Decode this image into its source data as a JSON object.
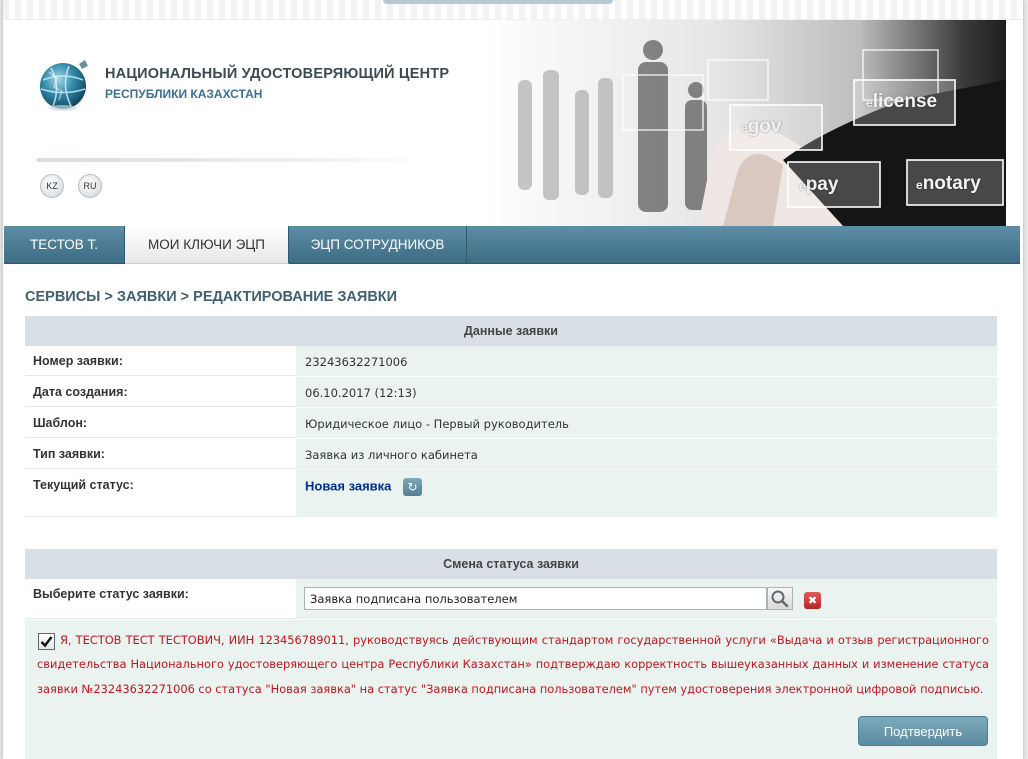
{
  "header": {
    "org_name": "НАЦИОНАЛЬНЫЙ УДОСТОВЕРЯЮЩИЙ ЦЕНТР",
    "org_sub": "РЕСПУБЛИКИ КАЗАХСТАН",
    "lang_kz": "KZ",
    "lang_ru": "RU",
    "banner": {
      "egov": "gov",
      "elicense": "license",
      "epay": "pay",
      "enotary": "notary",
      "prefix": "e"
    }
  },
  "nav": {
    "user": "ТЕСТОВ Т.",
    "my_keys": "МОИ КЛЮЧИ ЭЦП",
    "employee_keys": "ЭЦП СОТРУДНИКОВ",
    "active": "my_keys"
  },
  "breadcrumb": "СЕРВИСЫ > ЗАЯВКИ > РЕДАКТИРОВАНИЕ ЗАЯВКИ",
  "request_data": {
    "title": "Данные заявки",
    "rows": [
      {
        "label": "Номер заявки:",
        "value": "23243632271006"
      },
      {
        "label": "Дата создания:",
        "value": "06.10.2017 (12:13)"
      },
      {
        "label": "Шаблон:",
        "value": "Юридическое лицо - Первый руководитель"
      },
      {
        "label": "Тип заявки:",
        "value": "Заявка из личного кабинета"
      },
      {
        "label": "Текущий статус:",
        "value": "Новая заявка"
      }
    ]
  },
  "status_change": {
    "title": "Смена статуса заявки",
    "select_label": "Выберите статус заявки:",
    "selected_value": "Заявка подписана пользователем",
    "agree_checked": true,
    "agree_text": "Я, ТЕСТОВ ТЕСТ ТЕСТОВИЧ, ИИН 123456789011, руководствуясь действующим стандартом государственной услуги «Выдача и отзыв регистрационного свидетельства Национального удостоверяющего центра Республики Казахстан» подтверждаю корректность вышеуказанных данных и изменение статуса заявки №23243632271006 со статуса \"Новая заявка\" на статус \"Заявка подписана пользователем\" путем удостоверения электронной цифровой подписью.",
    "confirm_label": "Подтвердить"
  },
  "colors": {
    "nav": "#4a7a91",
    "status_link": "#002f8f",
    "agree_text": "#c0161f",
    "row_value_bg": "#ebf3f1",
    "section_head_bg": "#d8dfe5"
  }
}
